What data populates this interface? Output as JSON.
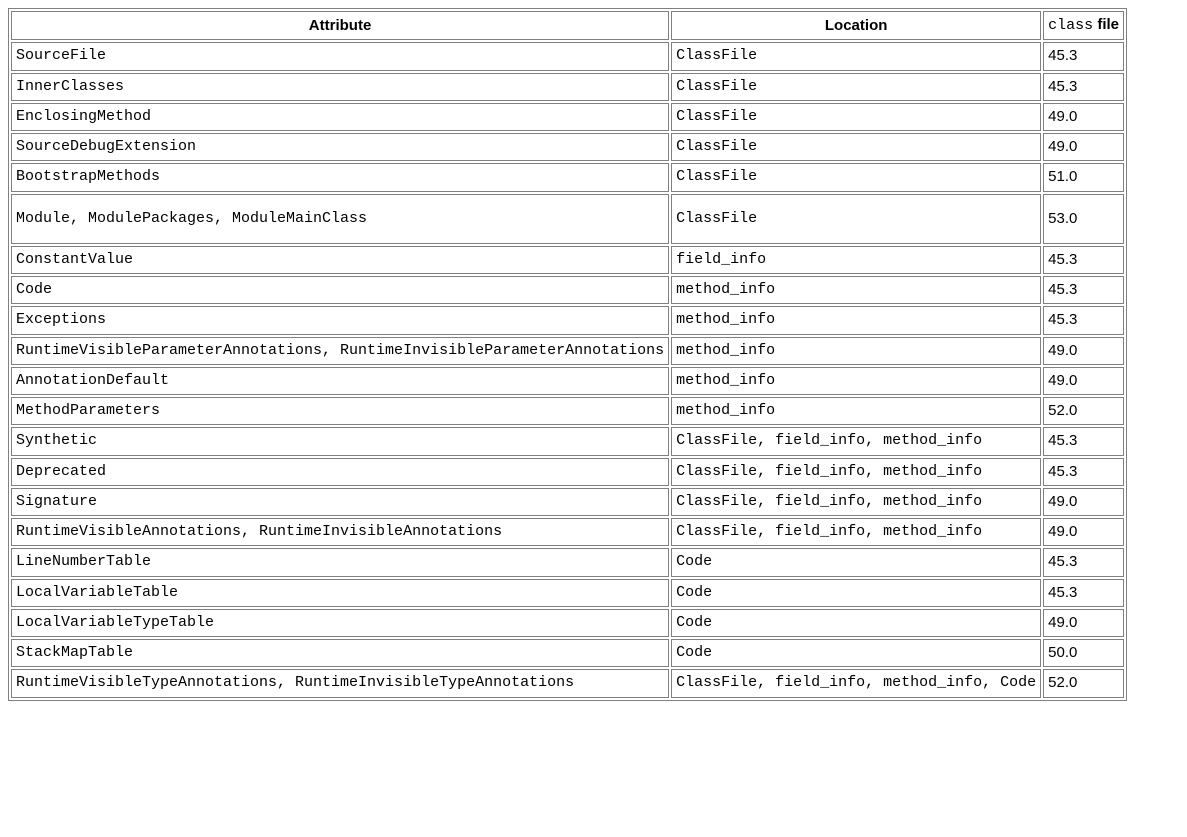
{
  "table": {
    "headers": {
      "attribute": "Attribute",
      "location": "Location",
      "class_code": "class",
      "class_file": " file"
    },
    "rows": [
      {
        "attribute": "SourceFile",
        "location": "ClassFile",
        "version": "45.3",
        "tall": false
      },
      {
        "attribute": "InnerClasses",
        "location": "ClassFile",
        "version": "45.3",
        "tall": false
      },
      {
        "attribute": "EnclosingMethod",
        "location": "ClassFile",
        "version": "49.0",
        "tall": false
      },
      {
        "attribute": "SourceDebugExtension",
        "location": "ClassFile",
        "version": "49.0",
        "tall": false
      },
      {
        "attribute": "BootstrapMethods",
        "location": "ClassFile",
        "version": "51.0",
        "tall": false
      },
      {
        "attribute": "Module, ModulePackages, ModuleMainClass",
        "location": "ClassFile",
        "version": "53.0",
        "tall": true
      },
      {
        "attribute": "ConstantValue",
        "location": "field_info",
        "version": "45.3",
        "tall": false
      },
      {
        "attribute": "Code",
        "location": "method_info",
        "version": "45.3",
        "tall": false
      },
      {
        "attribute": "Exceptions",
        "location": "method_info",
        "version": "45.3",
        "tall": false
      },
      {
        "attribute": "RuntimeVisibleParameterAnnotations, RuntimeInvisibleParameterAnnotations",
        "location": "method_info",
        "version": "49.0",
        "tall": false
      },
      {
        "attribute": "AnnotationDefault",
        "location": "method_info",
        "version": "49.0",
        "tall": false
      },
      {
        "attribute": "MethodParameters",
        "location": "method_info",
        "version": "52.0",
        "tall": false
      },
      {
        "attribute": "Synthetic",
        "location": "ClassFile, field_info, method_info",
        "version": "45.3",
        "tall": false
      },
      {
        "attribute": "Deprecated",
        "location": "ClassFile, field_info, method_info",
        "version": "45.3",
        "tall": false
      },
      {
        "attribute": "Signature",
        "location": "ClassFile, field_info, method_info",
        "version": "49.0",
        "tall": false
      },
      {
        "attribute": "RuntimeVisibleAnnotations, RuntimeInvisibleAnnotations",
        "location": "ClassFile, field_info, method_info",
        "version": "49.0",
        "tall": false
      },
      {
        "attribute": "LineNumberTable",
        "location": "Code",
        "version": "45.3",
        "tall": false
      },
      {
        "attribute": "LocalVariableTable",
        "location": "Code",
        "version": "45.3",
        "tall": false
      },
      {
        "attribute": "LocalVariableTypeTable",
        "location": "Code",
        "version": "49.0",
        "tall": false
      },
      {
        "attribute": "StackMapTable",
        "location": "Code",
        "version": "50.0",
        "tall": false
      },
      {
        "attribute": "RuntimeVisibleTypeAnnotations, RuntimeInvisibleTypeAnnotations",
        "location": "ClassFile, field_info, method_info, Code",
        "version": "52.0",
        "tall": false
      }
    ]
  }
}
